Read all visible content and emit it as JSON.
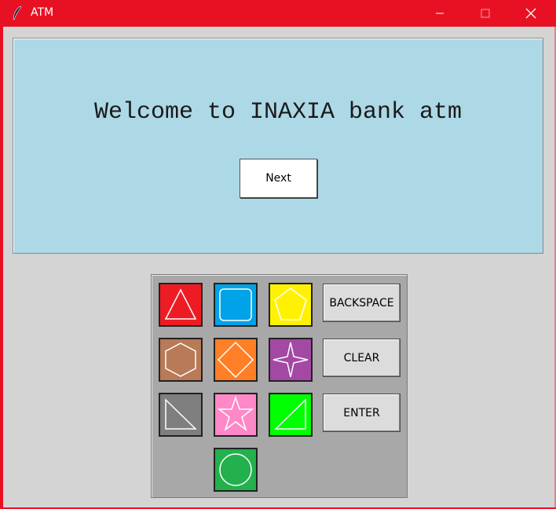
{
  "window": {
    "title": "ATM",
    "controls": [
      "minimize",
      "maximize",
      "close"
    ],
    "title_bar_color": "#e81123"
  },
  "screen": {
    "message": "Welcome to INAXIA bank atm",
    "next_label": "Next",
    "background": "#add8e6"
  },
  "keypad": {
    "shapes": [
      {
        "name": "triangle-icon",
        "color": "#ed1c24"
      },
      {
        "name": "rounded-square-icon",
        "color": "#00a2e8"
      },
      {
        "name": "pentagon-icon",
        "color": "#fff200"
      },
      {
        "name": "hexagon-icon",
        "color": "#b97a57"
      },
      {
        "name": "diamond-icon",
        "color": "#ff7f27"
      },
      {
        "name": "four-point-star-icon",
        "color": "#a349a4"
      },
      {
        "name": "right-triangle-icon",
        "color": "#7f7f7f"
      },
      {
        "name": "star-icon",
        "color": "#ff88c8"
      },
      {
        "name": "right-triangle-icon",
        "color": "#00ff00"
      },
      {
        "name": "circle-icon",
        "color": "#22b14c"
      }
    ],
    "backspace_label": "BACKSPACE",
    "clear_label": "CLEAR",
    "enter_label": "ENTER"
  }
}
